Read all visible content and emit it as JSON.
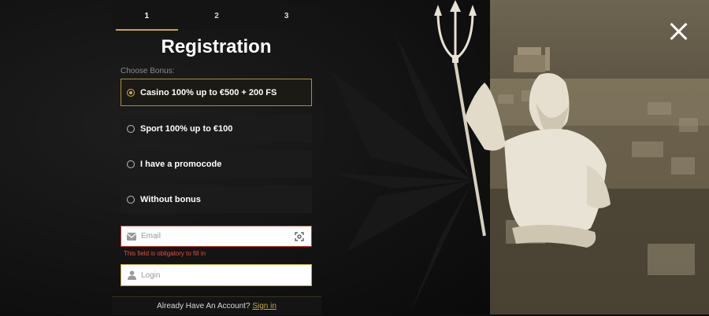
{
  "steps": [
    "1",
    "2",
    "3"
  ],
  "active_step": "1",
  "title": "Registration",
  "choose_label": "Choose Bonus:",
  "bonus_options": [
    {
      "label": "Casino 100% up to €500 + 200 FS",
      "selected": true
    },
    {
      "label": "Sport 100% up to €100",
      "selected": false
    },
    {
      "label": "I have a promocode",
      "selected": false
    },
    {
      "label": "Without bonus",
      "selected": false
    }
  ],
  "email": {
    "placeholder": "Email",
    "value": "",
    "error": "This field is obligatory to fill in"
  },
  "login": {
    "placeholder": "Login",
    "value": ""
  },
  "footer": {
    "text": "Already Have An Account?",
    "link": "Sign in"
  },
  "colors": {
    "accent": "#c9a441",
    "error": "#e74c3c",
    "panel": "#1b1b1b"
  }
}
